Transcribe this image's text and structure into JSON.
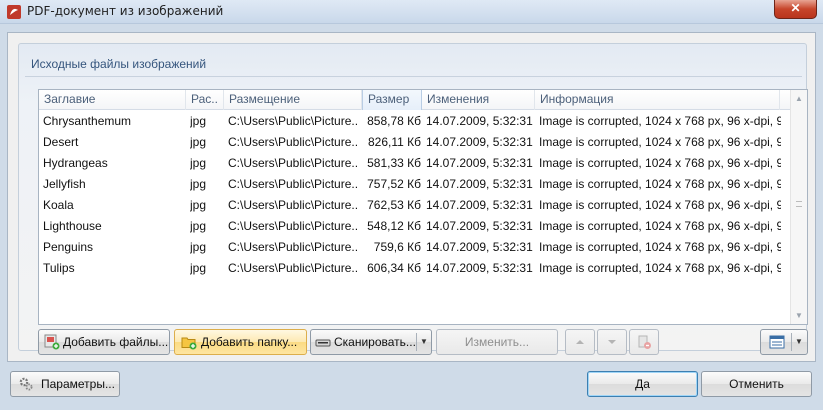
{
  "window": {
    "title": "PDF-документ из изображений",
    "close_label": "✕"
  },
  "group": {
    "title": "Исходные файлы изображений"
  },
  "columns": [
    "Заглавие",
    "Рас..",
    "Размещение",
    "Размер",
    "Изменения",
    "Информация"
  ],
  "sorted_column": "Размер",
  "rows": [
    {
      "name": "Chrysanthemum",
      "ext": "jpg",
      "path": "C:\\Users\\Public\\Picture..",
      "size": "858,78 Кб",
      "modified": "14.07.2009, 5:32:31",
      "info": "Image is corrupted, 1024 x 768 px, 96 x-dpi, 9.."
    },
    {
      "name": "Desert",
      "ext": "jpg",
      "path": "C:\\Users\\Public\\Picture..",
      "size": "826,11 Кб",
      "modified": "14.07.2009, 5:32:31",
      "info": "Image is corrupted, 1024 x 768 px, 96 x-dpi, 9.."
    },
    {
      "name": "Hydrangeas",
      "ext": "jpg",
      "path": "C:\\Users\\Public\\Picture..",
      "size": "581,33 Кб",
      "modified": "14.07.2009, 5:32:31",
      "info": "Image is corrupted, 1024 x 768 px, 96 x-dpi, 9.."
    },
    {
      "name": "Jellyfish",
      "ext": "jpg",
      "path": "C:\\Users\\Public\\Picture..",
      "size": "757,52 Кб",
      "modified": "14.07.2009, 5:32:31",
      "info": "Image is corrupted, 1024 x 768 px, 96 x-dpi, 9.."
    },
    {
      "name": "Koala",
      "ext": "jpg",
      "path": "C:\\Users\\Public\\Picture..",
      "size": "762,53 Кб",
      "modified": "14.07.2009, 5:32:31",
      "info": "Image is corrupted, 1024 x 768 px, 96 x-dpi, 9.."
    },
    {
      "name": "Lighthouse",
      "ext": "jpg",
      "path": "C:\\Users\\Public\\Picture..",
      "size": "548,12 Кб",
      "modified": "14.07.2009, 5:32:31",
      "info": "Image is corrupted, 1024 x 768 px, 96 x-dpi, 9.."
    },
    {
      "name": "Penguins",
      "ext": "jpg",
      "path": "C:\\Users\\Public\\Picture..",
      "size": "759,6 Кб",
      "modified": "14.07.2009, 5:32:31",
      "info": "Image is corrupted, 1024 x 768 px, 96 x-dpi, 9.."
    },
    {
      "name": "Tulips",
      "ext": "jpg",
      "path": "C:\\Users\\Public\\Picture..",
      "size": "606,34 Кб",
      "modified": "14.07.2009, 5:32:31",
      "info": "Image is corrupted, 1024 x 768 px, 96 x-dpi, 9.."
    }
  ],
  "toolbar": {
    "add_files": "Добавить файлы...",
    "add_folder": "Добавить папку...",
    "scan": "Сканировать...",
    "edit": "Изменить...",
    "icons": [
      "add-files-icon",
      "add-folder-icon",
      "scanner-icon",
      "move-up-icon",
      "move-down-icon",
      "delete-icon",
      "view-mode-icon"
    ]
  },
  "footer": {
    "settings": "Параметры...",
    "ok": "Да",
    "cancel": "Отменить"
  },
  "colors": {
    "accent": "#35557d",
    "hover": "#fde9b2",
    "window_frame": "#cfdbe8"
  }
}
